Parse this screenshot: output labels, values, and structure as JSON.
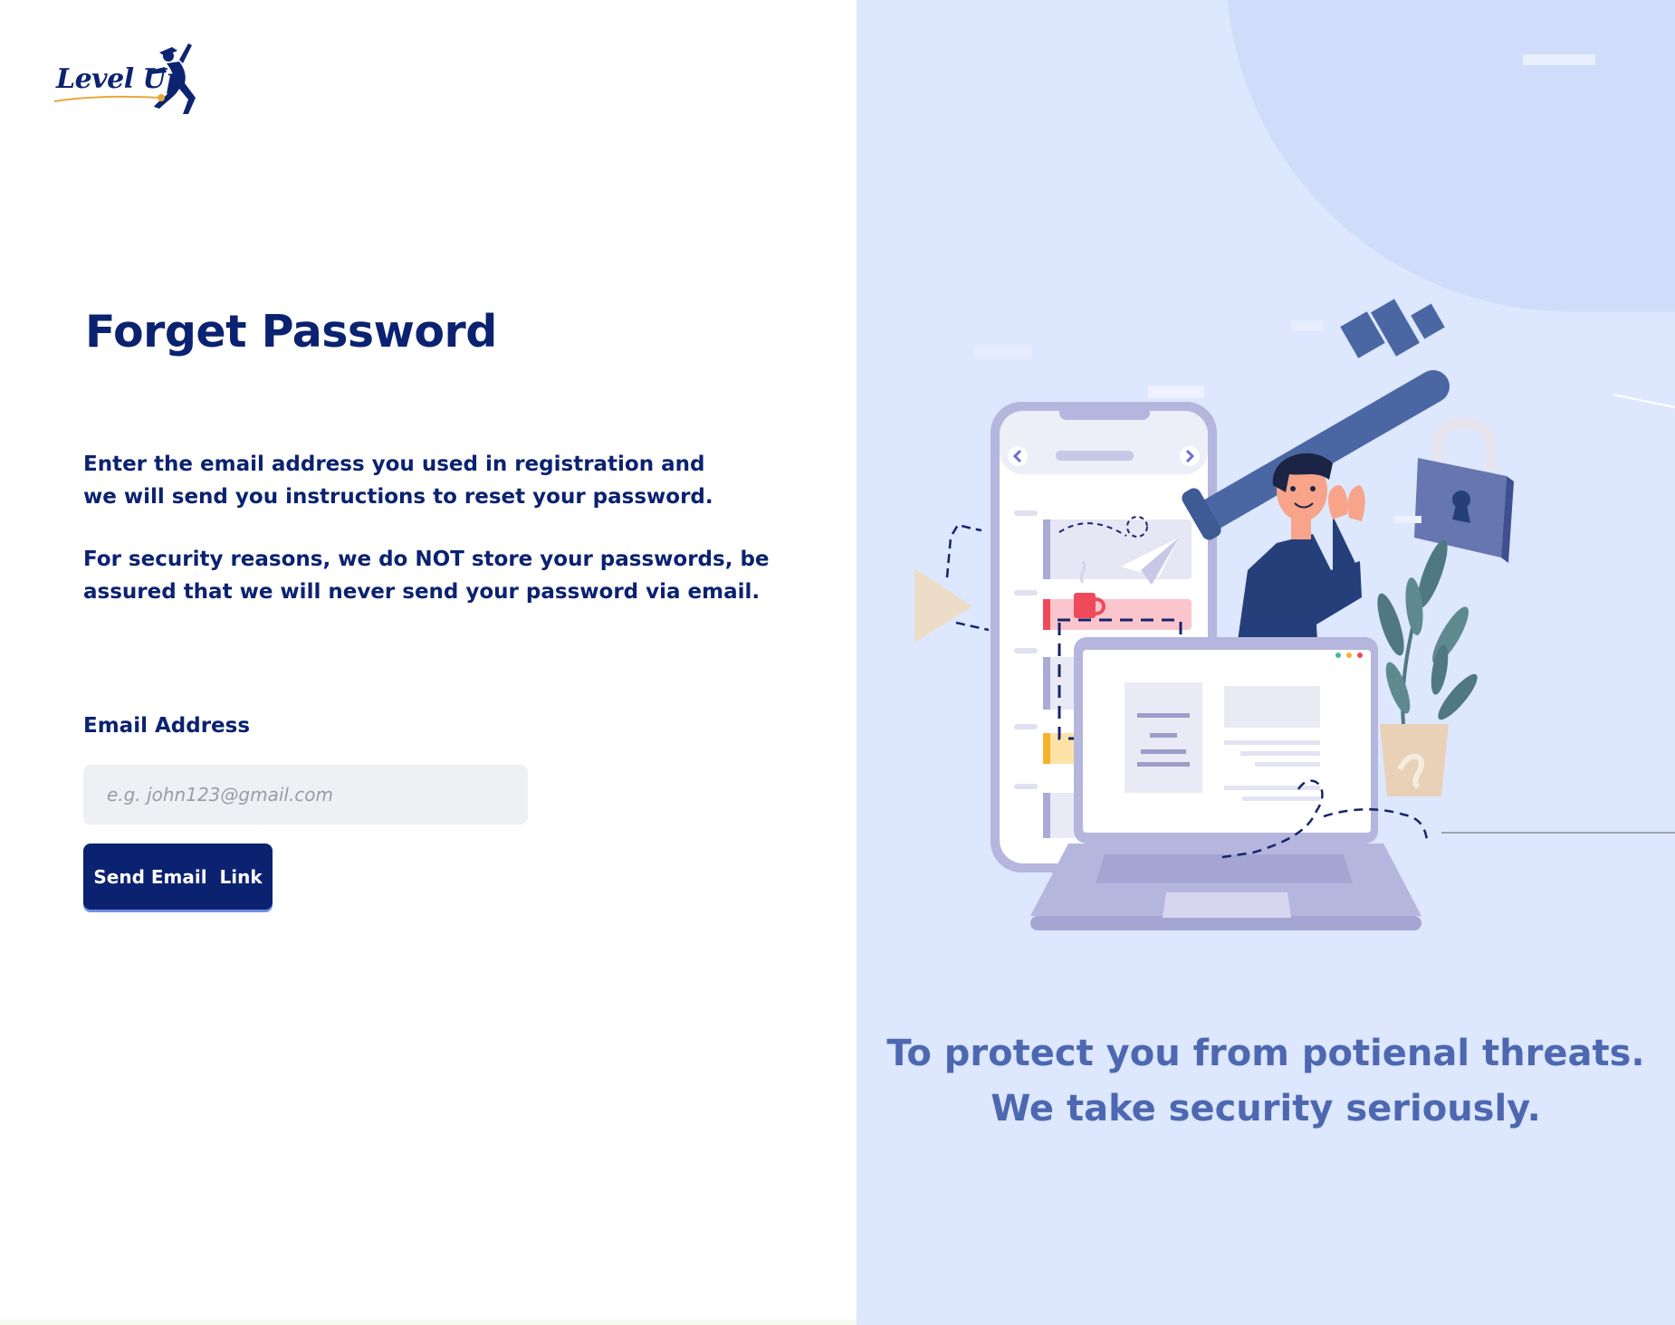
{
  "brand": {
    "logo_text": "Level Up"
  },
  "form": {
    "title": "Forget Password",
    "intro_lines": [
      "Enter the email address you used in registration and",
      "we will send you instructions to reset your password."
    ],
    "security_lines": [
      "For security reasons, we do NOT store your passwords, be",
      "assured that we will never send your password via email."
    ],
    "email_label": "Email Address",
    "email_placeholder": "e.g. john123@gmail.com",
    "email_value": "",
    "submit_label": "Send Email  Link"
  },
  "hero": {
    "tagline_lines": [
      "To protect you from potienal threats.",
      "We take security seriously."
    ],
    "illustration_icons": [
      "person-carrying-key-icon",
      "smartphone-icon",
      "laptop-icon",
      "padlock-icon",
      "plant-icon",
      "paper-plane-icon",
      "coffee-cup-icon",
      "play-triangle-icon"
    ]
  },
  "colors": {
    "primary": "#0b2270",
    "panel_bg": "#dde7fd",
    "blob": "#cfdcfa",
    "tagline": "#4d68b0",
    "input_bg": "#eff0f4",
    "accent_gold": "#e8a93a"
  }
}
